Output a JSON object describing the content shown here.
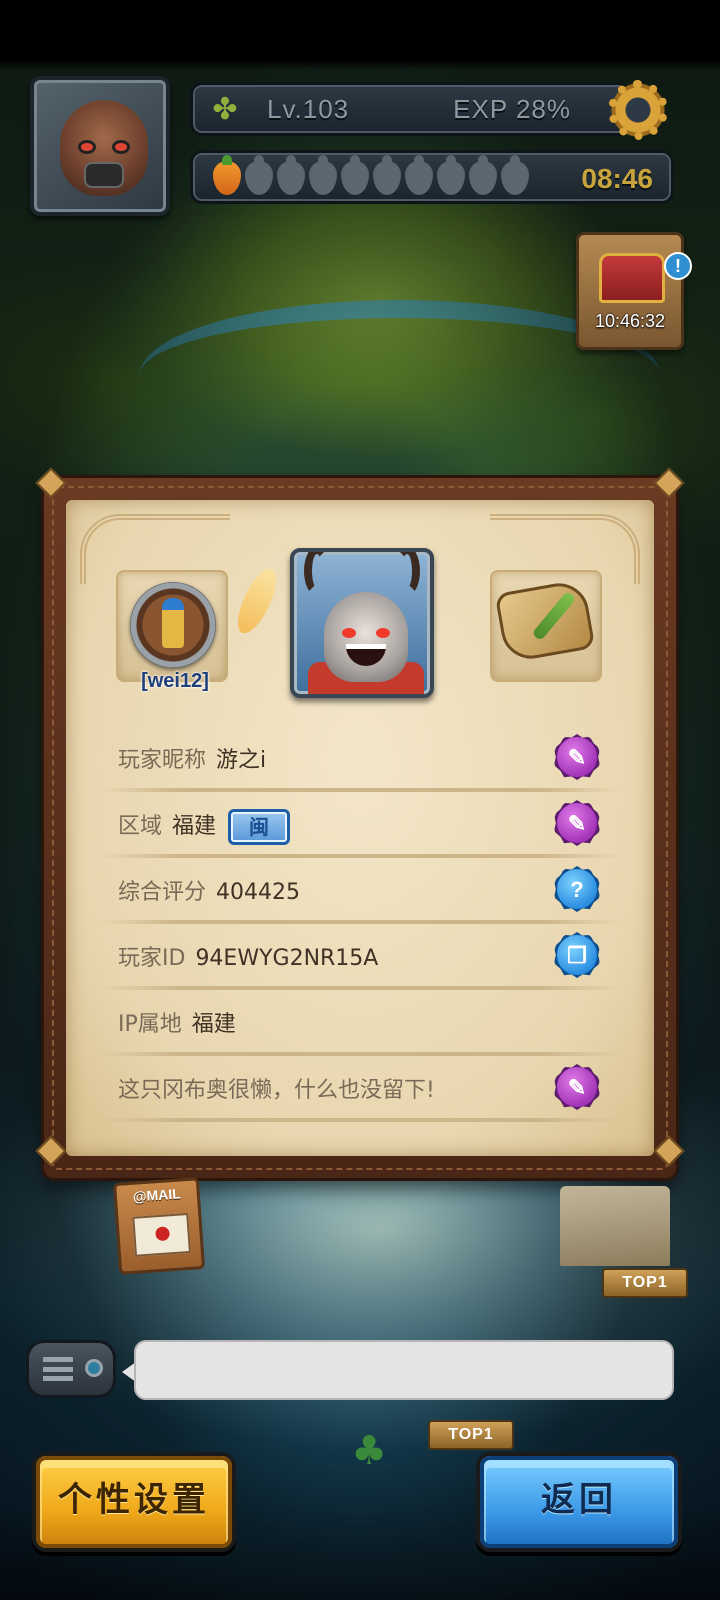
{
  "hud": {
    "level": "Lv.103",
    "exp": "EXP 28%",
    "energy_full": 1,
    "energy_total": 10,
    "timer": "08:46",
    "chest_timer": "10:46:32",
    "chest_badge": "!"
  },
  "profile": {
    "guild_tag": "[wei12]",
    "rows": [
      {
        "label": "玩家昵称",
        "value": "游之i",
        "button": "edit-icon"
      },
      {
        "label": "区域",
        "value": "福建",
        "badge": "闽",
        "button": "edit-icon"
      },
      {
        "label": "综合评分",
        "value": "404425",
        "button": "help-icon",
        "button_glyph": "?"
      },
      {
        "label": "玩家ID",
        "value": "94EWYG2NR15A",
        "button": "copy-icon"
      },
      {
        "label": "IP属地",
        "value": "福建"
      },
      {
        "label": "这只冈布奥很懒，什么也没留下!",
        "value": "",
        "button": "edit-icon"
      }
    ]
  },
  "map": {
    "mail_label": "@MAIL",
    "top_sign_1": "TOP1",
    "top_sign_2": "TOP1"
  },
  "buttons": {
    "personal": "个性设置",
    "back": "返回"
  },
  "colors": {
    "panel_parchment": "#e8d6af",
    "edit_button": "#a335b8",
    "info_button": "#2b8ee0",
    "personal_button": "#f0a81a",
    "back_button": "#3c9ae8"
  }
}
